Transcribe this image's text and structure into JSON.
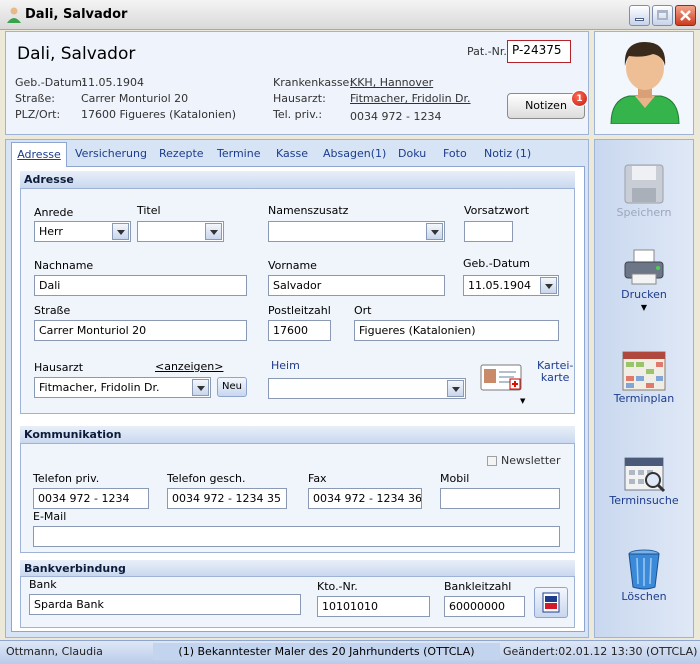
{
  "window": {
    "title": "Dali, Salvador"
  },
  "header": {
    "patient_name": "Dali, Salvador",
    "patnr_label": "Pat.-Nr.",
    "patnr_value": "P-24375",
    "geb_label": "Geb.-Datum:",
    "geb_value": "11.05.1904",
    "strasse_label": "Straße:",
    "strasse_value": "Carrer Monturiol 20",
    "plz_label": "PLZ/Ort:",
    "plz_value": "17600 Figueres (Katalonien)",
    "kasse_label": "Krankenkasse:",
    "kasse_value": "KKH, Hannover",
    "hausarzt_label": "Hausarzt:",
    "hausarzt_value": "Fitmacher, Fridolin Dr.",
    "tel_label": "Tel. priv.:",
    "tel_value": "0034 972 - 1234",
    "notizen_label": "Notizen",
    "notizen_count": "1"
  },
  "tabs": [
    "Adresse",
    "Versicherung",
    "Rezepte",
    "Termine",
    "Kasse",
    "Absagen(1)",
    "Doku",
    "Foto",
    "Notiz (1)"
  ],
  "adresse": {
    "title": "Adresse",
    "anrede_label": "Anrede",
    "anrede_value": "Herr",
    "titel_label": "Titel",
    "titel_value": "",
    "namenszusatz_label": "Namenszusatz",
    "namenszusatz_value": "",
    "vorsatzwort_label": "Vorsatzwort",
    "vorsatzwort_value": "",
    "nachname_label": "Nachname",
    "nachname_value": "Dali",
    "vorname_label": "Vorname",
    "vorname_value": "Salvador",
    "gebdatum_label": "Geb.-Datum",
    "gebdatum_value": "11.05.1904",
    "strasse_label": "Straße",
    "strasse_value": "Carrer Monturiol 20",
    "plz_label": "Postleitzahl",
    "plz_value": "17600",
    "ort_label": "Ort",
    "ort_value": "Figueres (Katalonien)",
    "hausarzt_label": "Hausarzt",
    "hausarzt_link": "<anzeigen>",
    "hausarzt_value": "Fitmacher, Fridolin Dr.",
    "neu_label": "Neu",
    "heim_label": "Heim",
    "heim_value": "",
    "karteikarte_label_1": "Kartei-",
    "karteikarte_label_2": "karte"
  },
  "kommunikation": {
    "title": "Kommunikation",
    "newsletter_label": "Newsletter",
    "tel_priv_label": "Telefon priv.",
    "tel_priv_value": "0034 972 - 1234",
    "tel_gesch_label": "Telefon gesch.",
    "tel_gesch_value": "0034 972 - 1234 35",
    "fax_label": "Fax",
    "fax_value": "0034 972 - 1234 36",
    "mobil_label": "Mobil",
    "mobil_value": "",
    "email_label": "E-Mail",
    "email_value": ""
  },
  "bank": {
    "title": "Bankverbindung",
    "bank_label": "Bank",
    "bank_value": "Sparda Bank",
    "kto_label": "Kto.-Nr.",
    "kto_value": "10101010",
    "blz_label": "Bankleitzahl",
    "blz_value": "60000000"
  },
  "sidebar": {
    "speichern": "Speichern",
    "drucken": "Drucken",
    "terminplan": "Terminplan",
    "terminsuche": "Terminsuche",
    "loeschen": "Löschen"
  },
  "status": {
    "user": "Ottmann, Claudia",
    "message": "(1) Bekanntester Maler des 20 Jahrhunderts (OTTCLA)",
    "changed": "Geändert:02.01.12 13:30 (OTTCLA)"
  }
}
